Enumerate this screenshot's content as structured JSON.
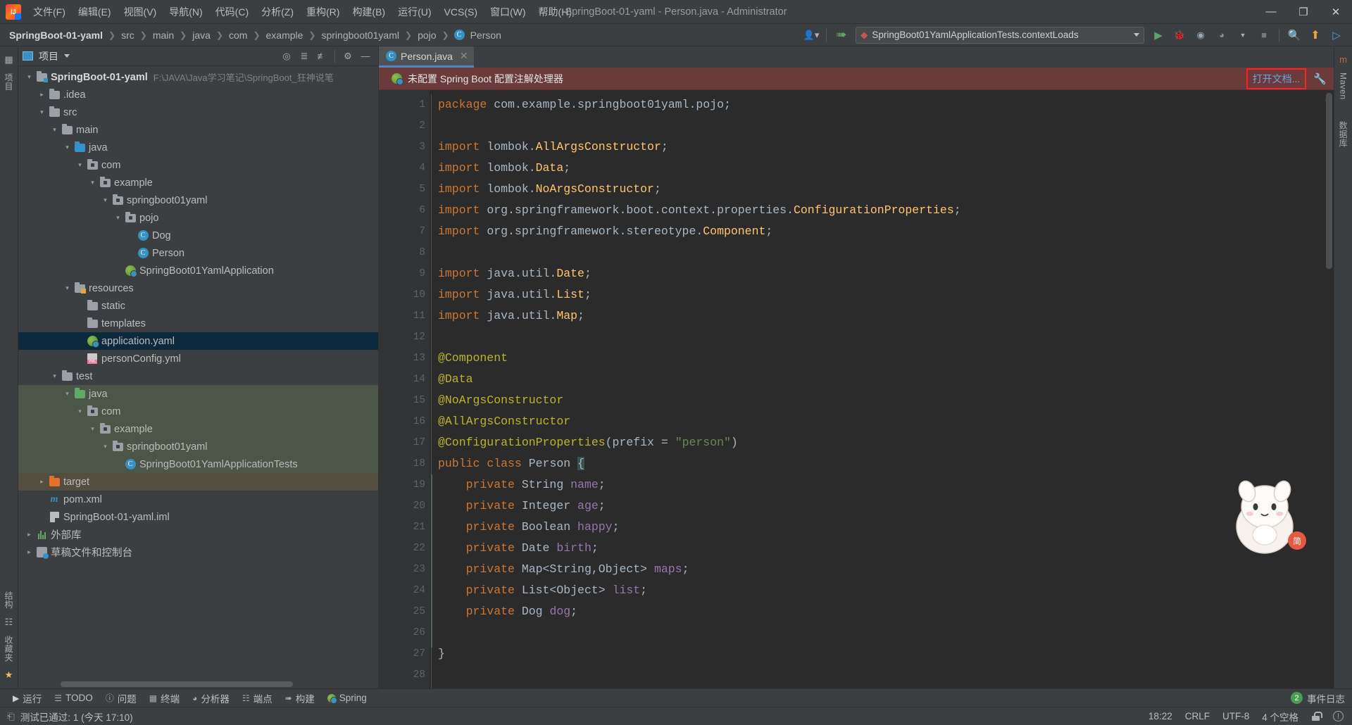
{
  "window": {
    "title": "SpringBoot-01-yaml - Person.java - Administrator",
    "minimize": "—",
    "maximize": "❐",
    "close": "✕"
  },
  "menu": [
    {
      "label": "文件(F)",
      "name": "menu-file"
    },
    {
      "label": "编辑(E)",
      "name": "menu-edit"
    },
    {
      "label": "视图(V)",
      "name": "menu-view"
    },
    {
      "label": "导航(N)",
      "name": "menu-navigate"
    },
    {
      "label": "代码(C)",
      "name": "menu-code"
    },
    {
      "label": "分析(Z)",
      "name": "menu-analyze"
    },
    {
      "label": "重构(R)",
      "name": "menu-refactor"
    },
    {
      "label": "构建(B)",
      "name": "menu-build"
    },
    {
      "label": "运行(U)",
      "name": "menu-run"
    },
    {
      "label": "VCS(S)",
      "name": "menu-vcs"
    },
    {
      "label": "窗口(W)",
      "name": "menu-window"
    },
    {
      "label": "帮助(H)",
      "name": "menu-help"
    }
  ],
  "navbar": {
    "breadcrumbs": [
      "SpringBoot-01-yaml",
      "src",
      "main",
      "java",
      "com",
      "example",
      "springboot01yaml",
      "pojo",
      "Person"
    ],
    "separator": "❯",
    "run_config": "SpringBoot01YamlApplicationTests.contextLoads",
    "icons": {
      "user": "user-icon",
      "vcs_update": "vcs-update-icon",
      "run": "run-icon",
      "debug": "debug-icon",
      "run_coverage": "run-with-coverage-icon",
      "profiler": "profiler-icon",
      "stop": "stop-icon",
      "search": "search-icon",
      "update_project": "update-project-icon",
      "ide_feature": "ide-feature-icon"
    }
  },
  "project_panel": {
    "title": "项目",
    "toolbar_icons": [
      "locate-icon",
      "expand-all-icon",
      "collapse-all-icon",
      "settings-gear-icon",
      "hide-icon"
    ],
    "tree": [
      {
        "label": "SpringBoot-01-yaml",
        "path": "F:\\JAVA\\Java学习笔记\\SpringBoot_狂神说笔",
        "depth": 0,
        "arrow": "open",
        "icon": "module-folder",
        "bold": true,
        "state": "none"
      },
      {
        "label": ".idea",
        "depth": 1,
        "arrow": "closed",
        "icon": "folder-gray",
        "state": "none"
      },
      {
        "label": "src",
        "depth": 1,
        "arrow": "open",
        "icon": "folder-gray",
        "state": "none"
      },
      {
        "label": "main",
        "depth": 2,
        "arrow": "open",
        "icon": "folder-gray",
        "state": "none"
      },
      {
        "label": "java",
        "depth": 3,
        "arrow": "open",
        "icon": "folder-blue",
        "state": "none"
      },
      {
        "label": "com",
        "depth": 4,
        "arrow": "open",
        "icon": "package",
        "state": "none"
      },
      {
        "label": "example",
        "depth": 5,
        "arrow": "open",
        "icon": "package",
        "state": "none"
      },
      {
        "label": "springboot01yaml",
        "depth": 6,
        "arrow": "open",
        "icon": "package",
        "state": "none"
      },
      {
        "label": "pojo",
        "depth": 7,
        "arrow": "open",
        "icon": "package",
        "state": "none"
      },
      {
        "label": "Dog",
        "depth": 8,
        "arrow": "none",
        "icon": "class",
        "state": "none"
      },
      {
        "label": "Person",
        "depth": 8,
        "arrow": "none",
        "icon": "class",
        "state": "none"
      },
      {
        "label": "SpringBoot01YamlApplication",
        "depth": 7,
        "arrow": "none",
        "icon": "spring-boot",
        "state": "none"
      },
      {
        "label": "resources",
        "depth": 3,
        "arrow": "open",
        "icon": "folder-resources",
        "state": "none"
      },
      {
        "label": "static",
        "depth": 4,
        "arrow": "none",
        "icon": "folder-gray",
        "state": "none"
      },
      {
        "label": "templates",
        "depth": 4,
        "arrow": "none",
        "icon": "folder-gray",
        "state": "none"
      },
      {
        "label": "application.yaml",
        "depth": 4,
        "arrow": "none",
        "icon": "spring-yaml",
        "state": "selected"
      },
      {
        "label": "personConfig.yml",
        "depth": 4,
        "arrow": "none",
        "icon": "yml",
        "state": "none"
      },
      {
        "label": "test",
        "depth": 2,
        "arrow": "open",
        "icon": "folder-gray",
        "state": "none"
      },
      {
        "label": "java",
        "depth": 3,
        "arrow": "open",
        "icon": "folder-green",
        "state": "test"
      },
      {
        "label": "com",
        "depth": 4,
        "arrow": "open",
        "icon": "package",
        "state": "test"
      },
      {
        "label": "example",
        "depth": 5,
        "arrow": "open",
        "icon": "package",
        "state": "test"
      },
      {
        "label": "springboot01yaml",
        "depth": 6,
        "arrow": "open",
        "icon": "package",
        "state": "test"
      },
      {
        "label": "SpringBoot01YamlApplicationTests",
        "depth": 7,
        "arrow": "none",
        "icon": "class-test",
        "state": "test"
      },
      {
        "label": "target",
        "depth": 1,
        "arrow": "closed",
        "icon": "folder-orange",
        "state": "target"
      },
      {
        "label": "pom.xml",
        "depth": 1,
        "arrow": "none",
        "icon": "maven",
        "state": "none"
      },
      {
        "label": "SpringBoot-01-yaml.iml",
        "depth": 1,
        "arrow": "none",
        "icon": "iml",
        "state": "none"
      },
      {
        "label": "外部库",
        "depth": 0,
        "arrow": "closed",
        "icon": "library",
        "state": "none"
      },
      {
        "label": "草稿文件和控制台",
        "depth": 0,
        "arrow": "closed",
        "icon": "scratches",
        "state": "none"
      }
    ]
  },
  "left_rail": {
    "top": [
      "项目"
    ],
    "bottom": [
      "结构",
      "收藏夹"
    ]
  },
  "right_rail": {
    "items": [
      "Maven",
      "数据库"
    ]
  },
  "editor": {
    "tab": {
      "label": "Person.java",
      "close": "✕",
      "icon": "java-class-icon"
    },
    "notification": {
      "icon": "spring-icon",
      "message": "未配置 Spring Boot 配置注解处理器",
      "action": "打开文档...",
      "wrench": "wrench-icon"
    },
    "lines": [
      {
        "n": 1,
        "fold": "none",
        "marker": "none",
        "tokens": [
          {
            "t": "package ",
            "c": "kw"
          },
          {
            "t": "com.example.springboot01yaml.pojo;",
            "c": "pln"
          }
        ]
      },
      {
        "n": 2,
        "fold": "none",
        "marker": "none",
        "tokens": []
      },
      {
        "n": 3,
        "fold": "open",
        "marker": "none",
        "tokens": [
          {
            "t": "import ",
            "c": "kw"
          },
          {
            "t": "lombok.",
            "c": "pln"
          },
          {
            "t": "AllArgsConstructor",
            "c": "cls"
          },
          {
            "t": ";",
            "c": "pln"
          }
        ]
      },
      {
        "n": 4,
        "fold": "none",
        "marker": "none",
        "tokens": [
          {
            "t": "import ",
            "c": "kw"
          },
          {
            "t": "lombok.",
            "c": "pln"
          },
          {
            "t": "Data",
            "c": "cls"
          },
          {
            "t": ";",
            "c": "pln"
          }
        ]
      },
      {
        "n": 5,
        "fold": "none",
        "marker": "none",
        "tokens": [
          {
            "t": "import ",
            "c": "kw"
          },
          {
            "t": "lombok.",
            "c": "pln"
          },
          {
            "t": "NoArgsConstructor",
            "c": "cls"
          },
          {
            "t": ";",
            "c": "pln"
          }
        ]
      },
      {
        "n": 6,
        "fold": "none",
        "marker": "none",
        "tokens": [
          {
            "t": "import ",
            "c": "kw"
          },
          {
            "t": "org.springframework.boot.context.properties.",
            "c": "pln"
          },
          {
            "t": "ConfigurationProperties",
            "c": "cls"
          },
          {
            "t": ";",
            "c": "pln"
          }
        ]
      },
      {
        "n": 7,
        "fold": "none",
        "marker": "none",
        "tokens": [
          {
            "t": "import ",
            "c": "kw"
          },
          {
            "t": "org.springframework.stereotype.",
            "c": "pln"
          },
          {
            "t": "Component",
            "c": "cls"
          },
          {
            "t": ";",
            "c": "pln"
          }
        ]
      },
      {
        "n": 8,
        "fold": "none",
        "marker": "none",
        "tokens": []
      },
      {
        "n": 9,
        "fold": "none",
        "marker": "none",
        "tokens": [
          {
            "t": "import ",
            "c": "kw"
          },
          {
            "t": "java.util.",
            "c": "pln"
          },
          {
            "t": "Date",
            "c": "cls"
          },
          {
            "t": ";",
            "c": "pln"
          }
        ]
      },
      {
        "n": 10,
        "fold": "none",
        "marker": "none",
        "tokens": [
          {
            "t": "import ",
            "c": "kw"
          },
          {
            "t": "java.util.",
            "c": "pln"
          },
          {
            "t": "List",
            "c": "cls"
          },
          {
            "t": ";",
            "c": "pln"
          }
        ]
      },
      {
        "n": 11,
        "fold": "close",
        "marker": "none",
        "tokens": [
          {
            "t": "import ",
            "c": "kw"
          },
          {
            "t": "java.util.",
            "c": "pln"
          },
          {
            "t": "Map",
            "c": "cls"
          },
          {
            "t": ";",
            "c": "pln"
          }
        ]
      },
      {
        "n": 12,
        "fold": "none",
        "marker": "none",
        "tokens": []
      },
      {
        "n": 13,
        "fold": "open",
        "marker": "none",
        "tokens": [
          {
            "t": "@Component",
            "c": "ann"
          }
        ]
      },
      {
        "n": 14,
        "fold": "none",
        "marker": "none",
        "tokens": [
          {
            "t": "@Data",
            "c": "ann"
          }
        ]
      },
      {
        "n": 15,
        "fold": "none",
        "marker": "none",
        "tokens": [
          {
            "t": "@NoArgsConstructor",
            "c": "ann"
          }
        ]
      },
      {
        "n": 16,
        "fold": "none",
        "marker": "none",
        "tokens": [
          {
            "t": "@AllArgsConstructor",
            "c": "ann"
          }
        ]
      },
      {
        "n": 17,
        "fold": "close",
        "marker": "bulb",
        "tokens": [
          {
            "t": "@ConfigurationProperties",
            "c": "ann"
          },
          {
            "t": "(",
            "c": "pln"
          },
          {
            "t": "prefix",
            "c": "pln"
          },
          {
            "t": " = ",
            "c": "pln"
          },
          {
            "t": "\"person\"",
            "c": "str"
          },
          {
            "t": ")",
            "c": "pln"
          }
        ]
      },
      {
        "n": 18,
        "fold": "none",
        "marker": "spring-bean",
        "tokens": [
          {
            "t": "public ",
            "c": "kw"
          },
          {
            "t": "class ",
            "c": "kw"
          },
          {
            "t": "Person ",
            "c": "pln"
          },
          {
            "t": "{",
            "c": "brace"
          }
        ]
      },
      {
        "n": 19,
        "fold": "none",
        "marker": "none",
        "tokens": [
          {
            "t": "    private ",
            "c": "kw"
          },
          {
            "t": "String ",
            "c": "pln"
          },
          {
            "t": "name",
            "c": "fld"
          },
          {
            "t": ";",
            "c": "pln"
          }
        ]
      },
      {
        "n": 20,
        "fold": "none",
        "marker": "none",
        "tokens": [
          {
            "t": "    private ",
            "c": "kw"
          },
          {
            "t": "Integer ",
            "c": "pln"
          },
          {
            "t": "age",
            "c": "fld"
          },
          {
            "t": ";",
            "c": "pln"
          }
        ]
      },
      {
        "n": 21,
        "fold": "none",
        "marker": "none",
        "tokens": [
          {
            "t": "    private ",
            "c": "kw"
          },
          {
            "t": "Boolean ",
            "c": "pln"
          },
          {
            "t": "happy",
            "c": "fld"
          },
          {
            "t": ";",
            "c": "pln"
          }
        ]
      },
      {
        "n": 22,
        "fold": "none",
        "marker": "none",
        "tokens": [
          {
            "t": "    private ",
            "c": "kw"
          },
          {
            "t": "Date ",
            "c": "pln"
          },
          {
            "t": "birth",
            "c": "fld"
          },
          {
            "t": ";",
            "c": "pln"
          }
        ]
      },
      {
        "n": 23,
        "fold": "none",
        "marker": "none",
        "tokens": [
          {
            "t": "    private ",
            "c": "kw"
          },
          {
            "t": "Map<String,Object> ",
            "c": "pln"
          },
          {
            "t": "maps",
            "c": "fld"
          },
          {
            "t": ";",
            "c": "pln"
          }
        ]
      },
      {
        "n": 24,
        "fold": "none",
        "marker": "none",
        "tokens": [
          {
            "t": "    private ",
            "c": "kw"
          },
          {
            "t": "List<Object> ",
            "c": "pln"
          },
          {
            "t": "list",
            "c": "fld"
          },
          {
            "t": ";",
            "c": "pln"
          }
        ]
      },
      {
        "n": 25,
        "fold": "none",
        "marker": "none",
        "tokens": [
          {
            "t": "    private ",
            "c": "kw"
          },
          {
            "t": "Dog ",
            "c": "pln"
          },
          {
            "t": "dog",
            "c": "fld"
          },
          {
            "t": ";",
            "c": "pln"
          }
        ]
      },
      {
        "n": 26,
        "fold": "none",
        "marker": "none",
        "tokens": []
      },
      {
        "n": 27,
        "fold": "none",
        "marker": "none",
        "tokens": [
          {
            "t": "}",
            "c": "pln"
          }
        ]
      },
      {
        "n": 28,
        "fold": "none",
        "marker": "none",
        "tokens": []
      }
    ]
  },
  "bottom_toolwindows": [
    {
      "label": "运行",
      "icon": "run-icon",
      "name": "toolwindow-run"
    },
    {
      "label": "TODO",
      "icon": "todo-icon",
      "name": "toolwindow-todo"
    },
    {
      "label": "问题",
      "icon": "problems-icon",
      "name": "toolwindow-problems"
    },
    {
      "label": "终端",
      "icon": "terminal-icon",
      "name": "toolwindow-terminal"
    },
    {
      "label": "分析器",
      "icon": "profiler-icon",
      "name": "toolwindow-profiler"
    },
    {
      "label": "端点",
      "icon": "endpoints-icon",
      "name": "toolwindow-endpoints"
    },
    {
      "label": "构建",
      "icon": "build-icon",
      "name": "toolwindow-build"
    },
    {
      "label": "Spring",
      "icon": "spring-icon",
      "name": "toolwindow-spring"
    }
  ],
  "event_log": {
    "badge": "2",
    "label": "事件日志"
  },
  "statusbar": {
    "message": "测试已通过: 1 (今天 17:10)",
    "position": "18:22",
    "line_separator": "CRLF",
    "encoding": "UTF-8",
    "indent": "4 个空格",
    "lock": "read-only-toggle",
    "inspections": "inspections-icon"
  }
}
